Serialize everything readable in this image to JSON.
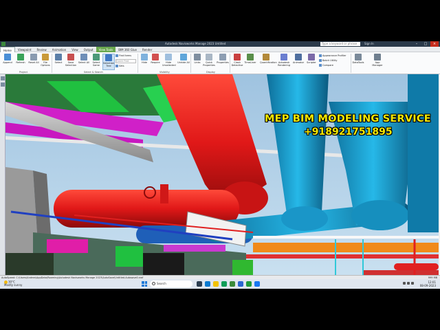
{
  "window": {
    "title": "Autodesk Navisworks Manage 2023   Untitled",
    "search_placeholder": "Type a keyword or phrase",
    "user": "Sign In"
  },
  "tabs": [
    "Home",
    "Viewpoint",
    "Review",
    "Animation",
    "View",
    "Output",
    "View Tools",
    "BIM 360 Glue",
    "Render"
  ],
  "ribbon": {
    "project_buttons": [
      "Append",
      "Refresh",
      "Reset All",
      "File Options"
    ],
    "project_group": "Project",
    "select_buttons": [
      "Select",
      "Save Selection",
      "Select All",
      "Select Same",
      "Selection Tree"
    ],
    "find_items": [
      "Find Items",
      "Quick Find",
      "Sets"
    ],
    "select_group": "Select & Search",
    "visibility_buttons": [
      "Hide",
      "Require",
      "Hide Unselected",
      "Unhide All"
    ],
    "visibility_group": "Visibility",
    "display_buttons": [
      "Links",
      "Quick Properties",
      "Properties"
    ],
    "display_group": "Display",
    "tools_buttons": [
      "Clash Detective",
      "TimeLiner",
      "Quantification",
      "Autodesk Rendering",
      "Animator",
      "Scripter"
    ],
    "tools_small": [
      "Appearance Profiler",
      "Batch Utility",
      "Compare"
    ],
    "extra_buttons": [
      "DataTools",
      "App Manager"
    ]
  },
  "overlay": {
    "line1": "MEP BIM MODELING SERVICE",
    "line2": "+918921751895"
  },
  "statusbar": {
    "path": "AutoSpeed: C:\\Users\\Andrea\\AppData\\Roaming\\Autodesk Navisworks Manage 2023\\AutoSave\\Untitled.Autosave0.nwf",
    "page": "1 of 1",
    "memory": "999 MB"
  },
  "taskbar": {
    "temperature": "30°C",
    "weather": "Mostly sunny",
    "search": "Search",
    "time": "12:01",
    "date": "08-09-2023"
  },
  "colors": {
    "accent_overlay": "#f5e800",
    "pipe_red": "#e02020",
    "pipe_cyan": "#1ea8d8",
    "duct_magenta": "#e020c8",
    "tab_highlight": "#6aa84f"
  }
}
